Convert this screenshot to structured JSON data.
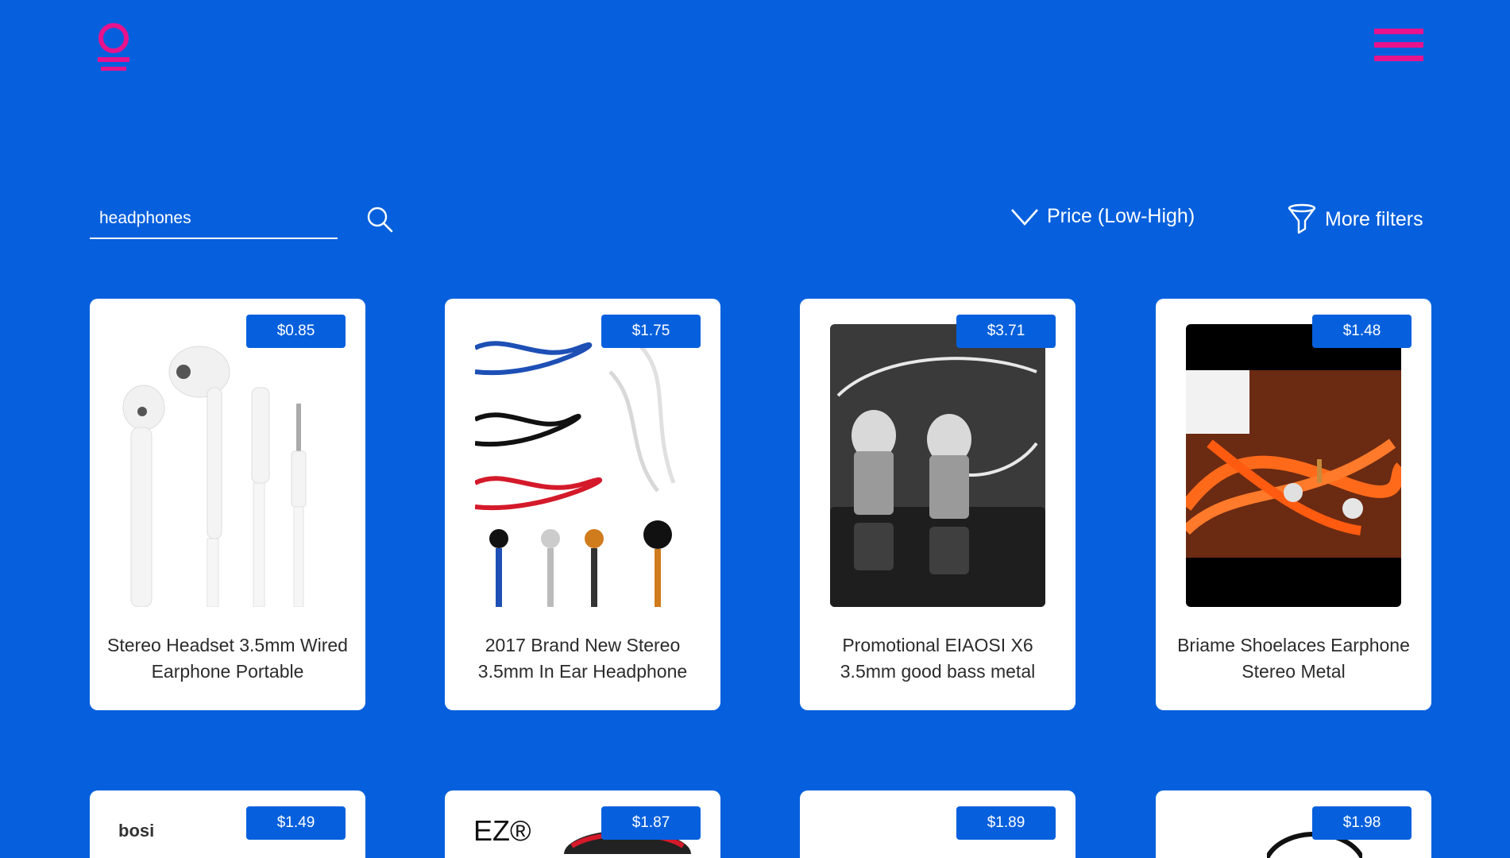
{
  "search": {
    "value": "headphones",
    "placeholder": ""
  },
  "sort": {
    "label": "Price (Low-High)"
  },
  "filters": {
    "label": "More filters"
  },
  "colors": {
    "background": "#0660DD",
    "accent": "#E8128C",
    "card": "#ffffff",
    "price_badge": "#0660DD"
  },
  "products": [
    {
      "price": "$0.85",
      "title": "Stereo Headset 3.5mm Wired Earphone Portable"
    },
    {
      "price": "$1.75",
      "title": "2017 Brand New Stereo 3.5mm In Ear Headphone"
    },
    {
      "price": "$3.71",
      "title": "Promotional EIAOSI X6 3.5mm good bass metal"
    },
    {
      "price": "$1.48",
      "title": "Briame Shoelaces Earphone Stereo Metal"
    },
    {
      "price": "$1.49",
      "title": "",
      "image_text": "bosi"
    },
    {
      "price": "$1.87",
      "title": "",
      "image_text": "EZ®"
    },
    {
      "price": "$1.89",
      "title": ""
    },
    {
      "price": "$1.98",
      "title": ""
    }
  ]
}
